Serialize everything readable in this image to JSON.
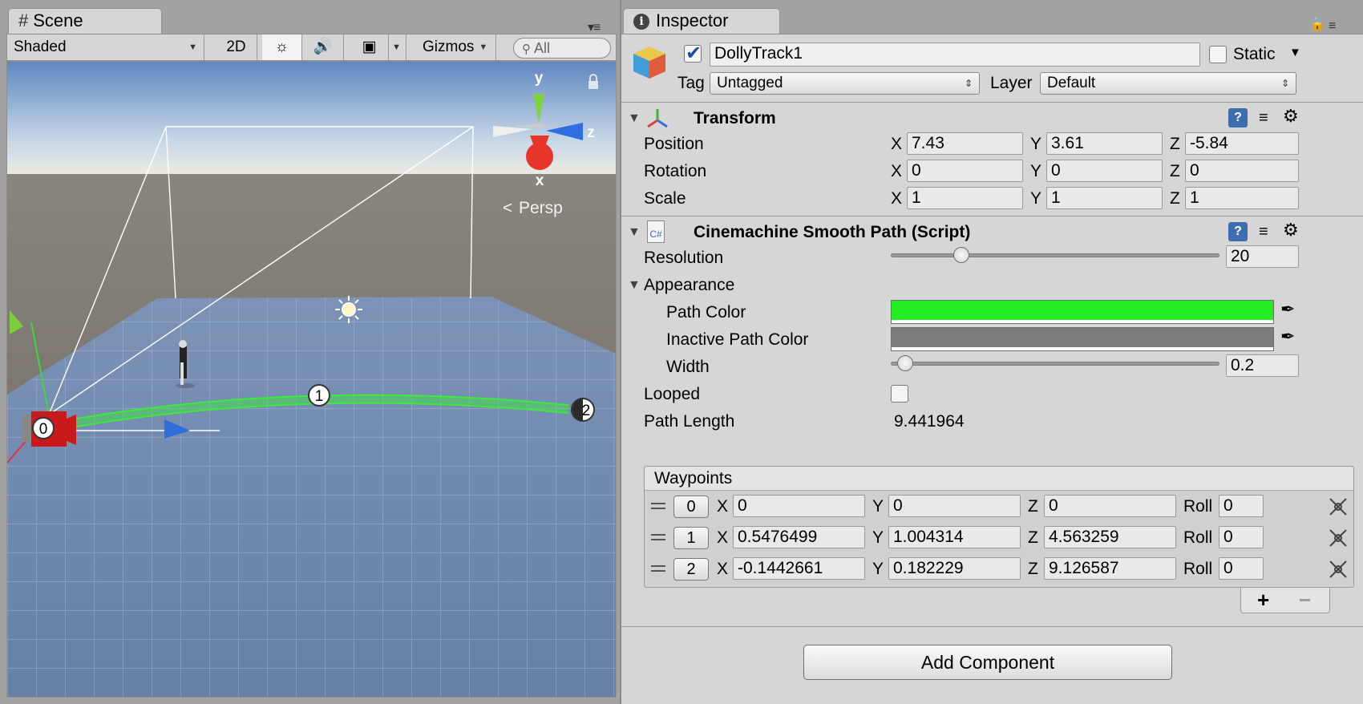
{
  "scene": {
    "tab_label": "Scene",
    "toolbar": {
      "shading_mode": "Shaded",
      "mode_2d": "2D",
      "gizmos_label": "Gizmos",
      "search_placeholder": "All"
    },
    "viewport": {
      "persp_label": "Persp",
      "gizmo_axes": {
        "y": "y",
        "x": "x",
        "z": "z"
      },
      "waypoint_labels": [
        "0",
        "1",
        "2"
      ],
      "path_color": "#3ee83e",
      "sky_top": "#5f87c0",
      "ground_color": "#6f85a8"
    }
  },
  "inspector": {
    "tab_label": "Inspector",
    "object": {
      "active": true,
      "name": "DollyTrack1",
      "static_label": "Static",
      "static": false,
      "tag_label": "Tag",
      "tag_value": "Untagged",
      "layer_label": "Layer",
      "layer_value": "Default"
    },
    "transform": {
      "title": "Transform",
      "rows": [
        {
          "label": "Position",
          "x": "7.43",
          "y": "3.61",
          "z": "-5.84"
        },
        {
          "label": "Rotation",
          "x": "0",
          "y": "0",
          "z": "0"
        },
        {
          "label": "Scale",
          "x": "1",
          "y": "1",
          "z": "1"
        }
      ],
      "axis_labels": {
        "x": "X",
        "y": "Y",
        "z": "Z"
      }
    },
    "smooth_path": {
      "title": "Cinemachine Smooth Path (Script)",
      "script_icon_text": "C#",
      "resolution_label": "Resolution",
      "resolution_value": "20",
      "resolution_fraction": 0.2,
      "appearance_label": "Appearance",
      "path_color_label": "Path Color",
      "path_color": "#22ee22",
      "inactive_path_color_label": "Inactive Path Color",
      "inactive_path_color": "#7c7c7c",
      "width_label": "Width",
      "width_value": "0.2",
      "width_fraction": 0.02,
      "looped_label": "Looped",
      "looped": false,
      "path_length_label": "Path Length",
      "path_length_value": "9.441964",
      "waypoints_label": "Waypoints",
      "roll_label": "Roll",
      "waypoints": [
        {
          "index": "0",
          "x": "0",
          "y": "0",
          "z": "0",
          "roll": "0"
        },
        {
          "index": "1",
          "x": "0.5476499",
          "y": "1.004314",
          "z": "4.563259",
          "roll": "0"
        },
        {
          "index": "2",
          "x": "-0.1442661",
          "y": "0.182229",
          "z": "9.126587",
          "roll": "0"
        }
      ],
      "add_label": "+",
      "remove_label": "−"
    },
    "add_component_label": "Add Component"
  }
}
